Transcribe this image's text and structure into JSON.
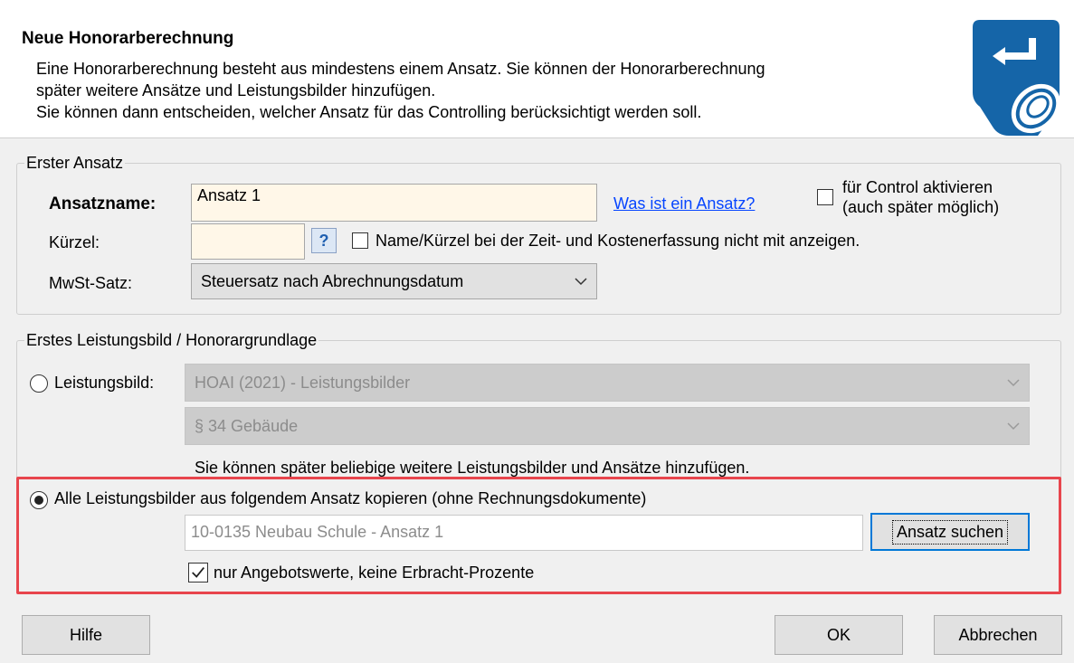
{
  "header": {
    "title": "Neue Honorarberechnung",
    "line1": "Eine Honorarberechnung besteht aus mindestens einem Ansatz. Sie können der Honorarberechnung",
    "line2": "später weitere Ansätze und Leistungsbilder hinzufügen.",
    "line3": "Sie können dann entscheiden, welcher Ansatz für das Controlling berücksichtigt werden soll.",
    "logo_icon": "enter-key-touch-icon",
    "logo_color": "#1565a8"
  },
  "erster_ansatz": {
    "legend": "Erster Ansatz",
    "name_label": "Ansatzname:",
    "name_value": "Ansatz 1",
    "help_link": "Was ist ein Ansatz?",
    "control_checkbox_line1": "für Control aktivieren",
    "control_checkbox_line2": "(auch später möglich)",
    "kuerzel_label": "Kürzel:",
    "kuerzel_value": "",
    "kuerzel_help": "?",
    "hide_checkbox_label": "Name/Kürzel bei der Zeit- und Kostenerfassung nicht mit anzeigen.",
    "mwst_label": "MwSt-Satz:",
    "mwst_value": "Steuersatz nach Abrechnungsdatum"
  },
  "leistungsbild": {
    "legend": "Erstes Leistungsbild / Honorargrundlage",
    "radio_label": "Leistungsbild:",
    "select1_value": "HOAI (2021) - Leistungsbilder",
    "select2_value": "§ 34 Gebäude",
    "hint": "Sie können später beliebige weitere Leistungsbilder und Ansätze hinzufügen.",
    "copy_radio_label": "Alle Leistungsbilder aus folgendem Ansatz kopieren (ohne Rechnungsdokumente)",
    "copy_source_value": "10-0135 Neubau Schule - Ansatz 1",
    "search_button": "Ansatz suchen",
    "only_offer_checkbox": "nur Angebotswerte, keine Erbracht-Prozente"
  },
  "footer": {
    "help_button": "Hilfe",
    "ok_button": "OK",
    "cancel_button": "Abbrechen"
  }
}
